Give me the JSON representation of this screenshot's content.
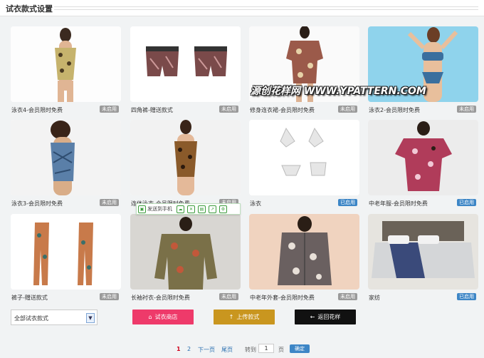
{
  "header": {
    "title": "试衣款式设置"
  },
  "watermark": "源创花样网 WWW.YPATTERN.COM",
  "phone_toolbar": {
    "label": "发送到手机"
  },
  "items": [
    {
      "name": "泳衣4-会员限时免费",
      "status": "未启用"
    },
    {
      "name": "四角裤-赠送款式",
      "status": "未启用"
    },
    {
      "name": "修身连衣裙-会员限时免费",
      "status": "未启用"
    },
    {
      "name": "泳衣2-会员限时免费",
      "status": "未启用"
    },
    {
      "name": "泳衣3-会员限时免费",
      "status": "未启用"
    },
    {
      "name": "连体泳衣-会员限时免费",
      "status": "未启用"
    },
    {
      "name": "泳衣",
      "status": "已启用"
    },
    {
      "name": "中老年服-会员限时免费",
      "status": "已启用"
    },
    {
      "name": "裤子-赠送款式",
      "status": "未启用"
    },
    {
      "name": "长袖衬衣-会员限时免费",
      "status": "未启用"
    },
    {
      "name": "中老年外套-会员限时免费",
      "status": "未启用"
    },
    {
      "name": "家纺",
      "status": "已启用"
    }
  ],
  "filter": {
    "selected": "全部试衣款式"
  },
  "buttons": {
    "shop": "试衣商店",
    "upload": "上传款式",
    "back": "返回花样"
  },
  "colors": {
    "shop": "#ee3a6a",
    "upload": "#c9961f",
    "back": "#111111",
    "enabled": "#3d86c6",
    "disabled": "#9a9a9a"
  },
  "pager": {
    "current": "1",
    "page2": "2",
    "next": "下一页",
    "last": "尾页",
    "goto": "转到",
    "page_value": "1",
    "page_unit": "页",
    "confirm": "确定"
  }
}
